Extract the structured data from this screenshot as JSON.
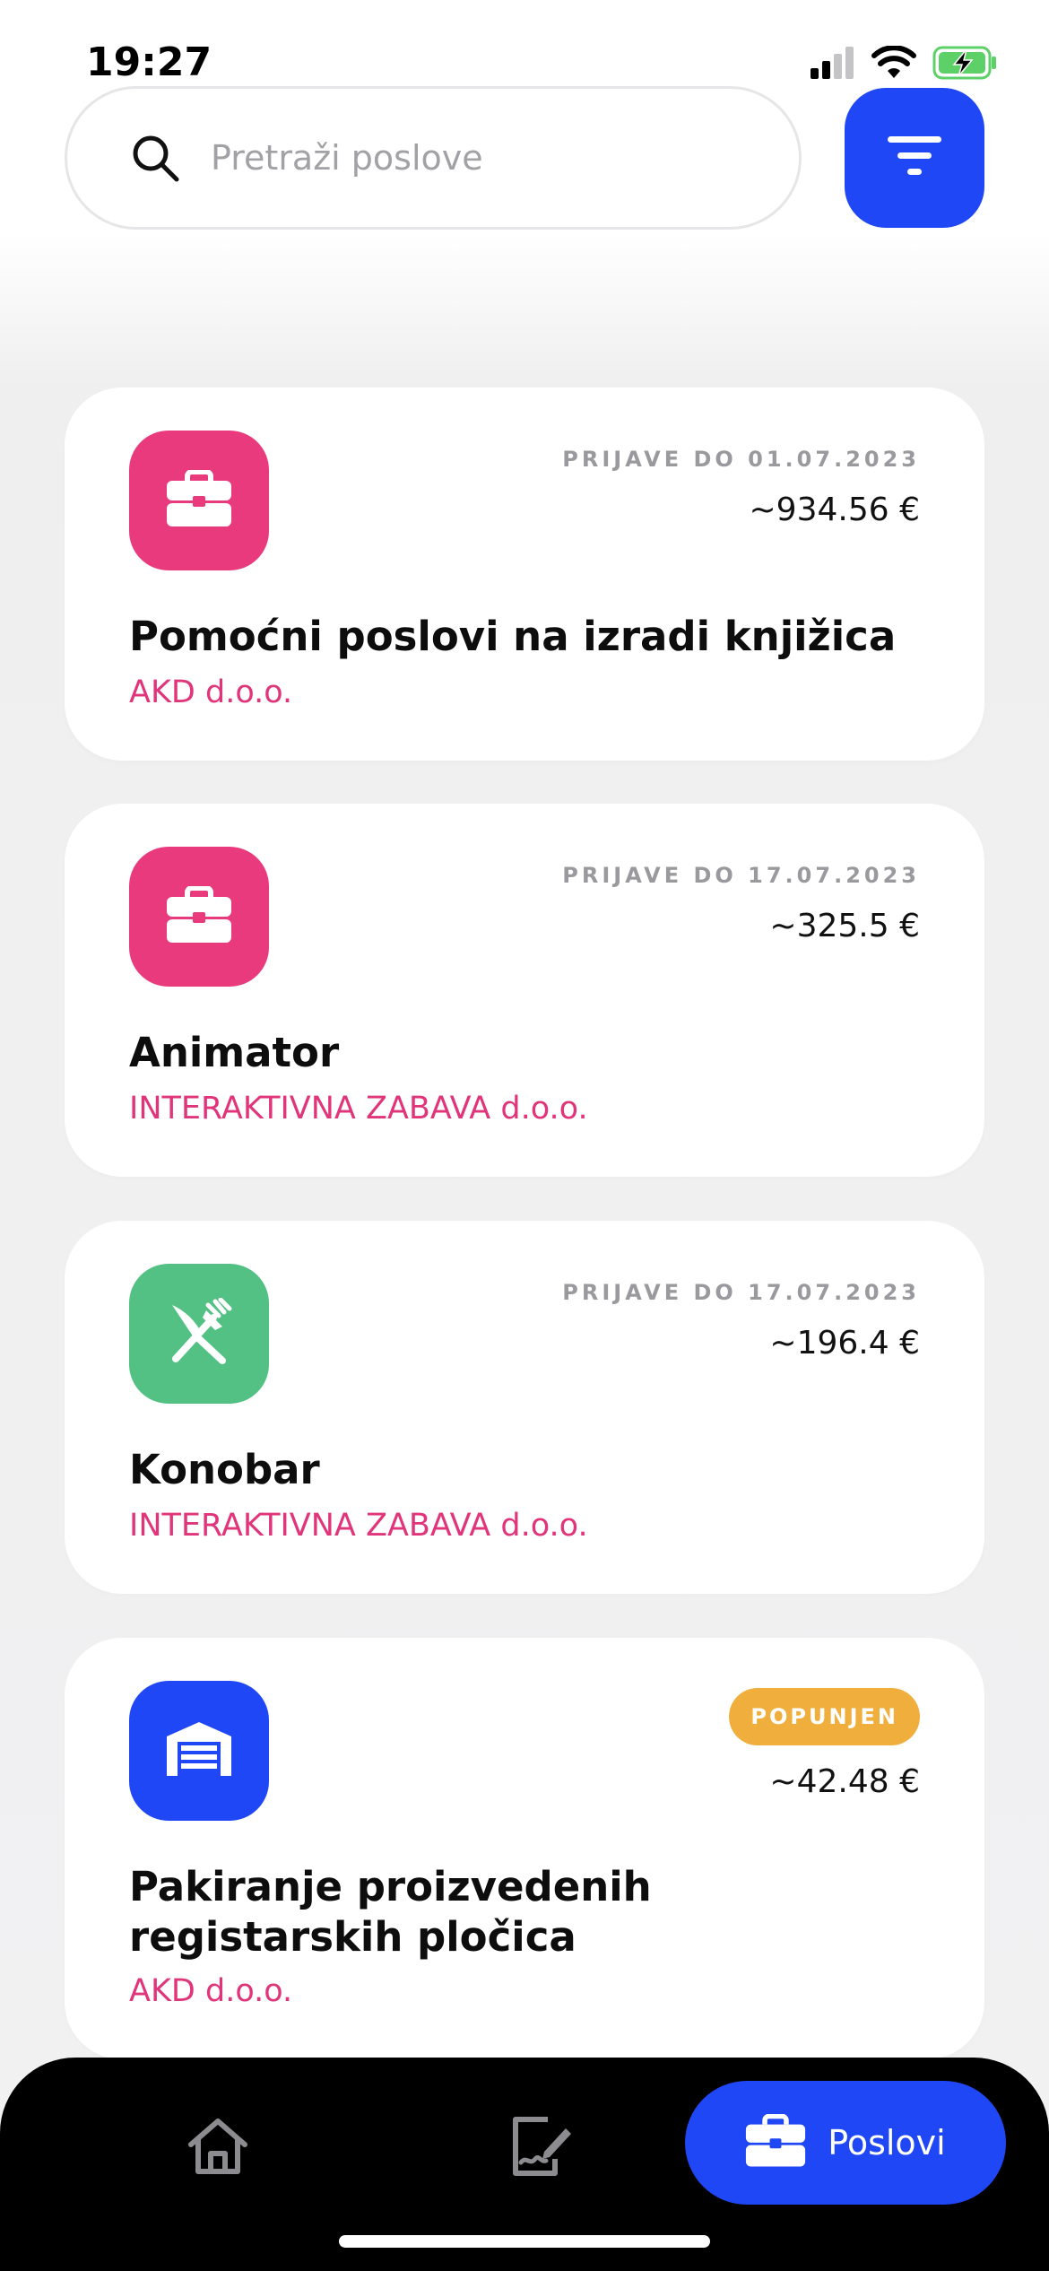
{
  "status_bar": {
    "time": "19:27"
  },
  "search": {
    "placeholder": "Pretraži poslove"
  },
  "jobs": [
    {
      "icon": "briefcase-icon",
      "icon_color": "#ea3a7e",
      "deadline": "PRIJAVE DO 01.07.2023",
      "price": "~934.56 €",
      "title": "Pomoćni poslovi na izradi knjižica",
      "company": "AKD d.o.o."
    },
    {
      "icon": "briefcase-icon",
      "icon_color": "#ea3a7e",
      "deadline": "PRIJAVE DO 17.07.2023",
      "price": "~325.5 €",
      "title": "Animator",
      "company": "INTERAKTIVNA ZABAVA d.o.o."
    },
    {
      "icon": "fork-knife-icon",
      "icon_color": "#53c084",
      "deadline": "PRIJAVE DO 17.07.2023",
      "price": "~196.4 €",
      "title": "Konobar",
      "company": "INTERAKTIVNA ZABAVA d.o.o."
    },
    {
      "icon": "warehouse-icon",
      "icon_color": "#1f47f5",
      "badge": "POPUNJEN",
      "badge_color": "#f0ae3d",
      "price": "~42.48 €",
      "title": "Pakiranje proizvedenih registarskih pločica",
      "company": "AKD d.o.o."
    }
  ],
  "tab_bar": {
    "tabs": [
      {
        "icon": "home-icon",
        "active": false
      },
      {
        "icon": "document-sign-icon",
        "active": false
      },
      {
        "icon": "briefcase-icon",
        "label": "Poslovi",
        "active": true
      }
    ]
  },
  "colors": {
    "accent": "#1f47f5",
    "company_text": "#e0357a"
  }
}
